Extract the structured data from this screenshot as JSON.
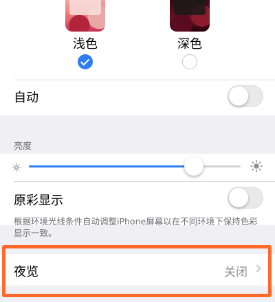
{
  "appearance": {
    "light_label": "浅色",
    "dark_label": "深色",
    "selected": "light",
    "light_selected": true,
    "dark_selected": false
  },
  "auto": {
    "label": "自动",
    "enabled": false
  },
  "brightness": {
    "header": "亮度",
    "level": 0.78,
    "min_icon": "sun-small-icon",
    "max_icon": "sun-large-icon"
  },
  "true_tone": {
    "label": "原彩显示",
    "enabled": false,
    "footnote": "根据环境光线条件自动调整iPhone屏幕以在不同环境下保持色彩显示一致。"
  },
  "night_shift": {
    "label": "夜览",
    "value": "关闭"
  },
  "colors": {
    "accent": "#2f7df6",
    "highlight": "#ff6a2b",
    "background": "#efeff4"
  }
}
